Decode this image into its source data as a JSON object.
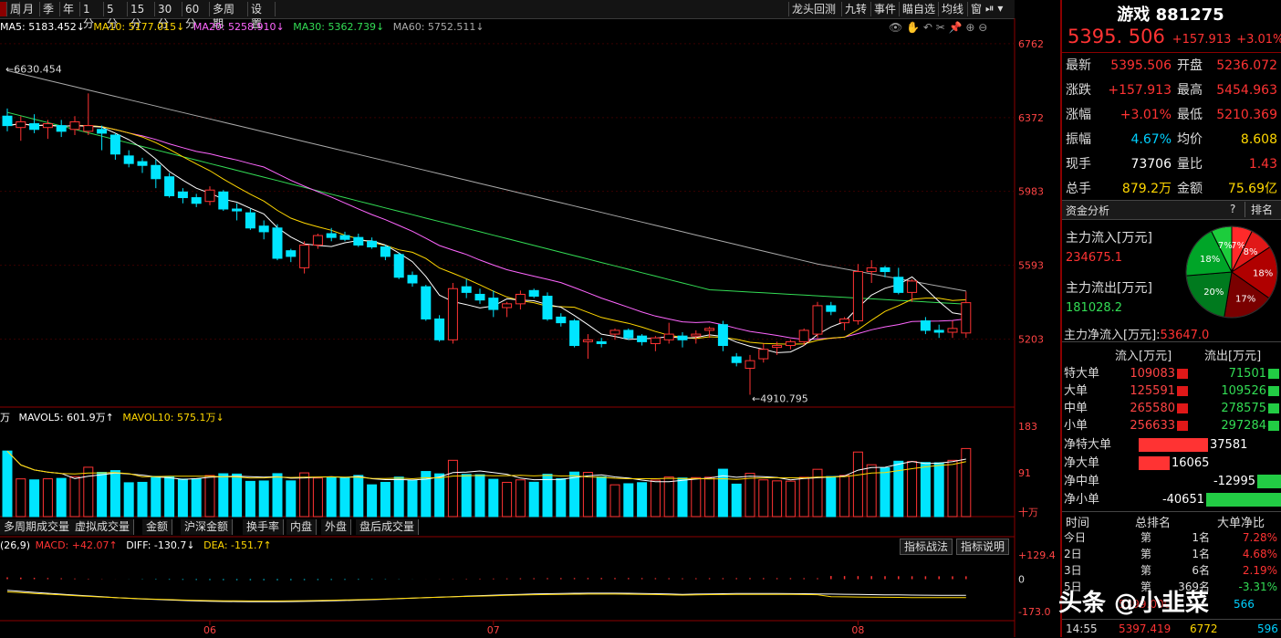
{
  "toolbar": {
    "periods": [
      "周",
      "月",
      "季",
      "年",
      "1分",
      "5分",
      "15分",
      "30分",
      "60分",
      "多周期",
      "设置"
    ],
    "active_period": "日",
    "right_tools": [
      "龙头回测",
      "九转",
      "事件",
      "瞄自选",
      "均线",
      "窗"
    ]
  },
  "ma_bar": {
    "ma5": "MA5: 5183.452↓",
    "ma10": "MA10: 5177.015↓",
    "ma20": "MA20: 5258.910↓",
    "ma30": "MA30: 5362.739↓",
    "ma60": "MA60: 5752.511↓"
  },
  "price_axis": [
    "6762",
    "6372",
    "5983",
    "5593",
    "5203"
  ],
  "price_annotations": {
    "high": "6630.454",
    "low": "4910.795"
  },
  "vol_bar": {
    "unit": "万",
    "mavol5": "MAVOL5: 601.9万↑",
    "mavol10": "MAVOL10: 575.1万↓"
  },
  "vol_axis": [
    "183",
    "91",
    "十万"
  ],
  "sub_tabs": [
    "多周期成交量",
    "虚拟成交量",
    "金额",
    "沪深金额",
    "换手率",
    "内盘",
    "外盘",
    "盘后成交量"
  ],
  "macd_bar": {
    "params": "(26,9)",
    "macd": "MACD: +42.07↑",
    "diff": "DIFF: -130.7↓",
    "dea": "DEA: -151.7↑"
  },
  "macd_axis": [
    "+129.4",
    "0",
    "-173.0"
  ],
  "macd_buttons": [
    "指标战法",
    "指标说明"
  ],
  "x_axis": [
    "06",
    "07",
    "08"
  ],
  "header": {
    "name": "游戏",
    "code": "881275",
    "price": "5395. 506",
    "change": "+157.913",
    "pct": "+3.01%"
  },
  "quote": [
    {
      "l1": "最新",
      "v1": "5395.506",
      "c1": "red",
      "l2": "开盘",
      "v2": "5236.072",
      "c2": "red"
    },
    {
      "l1": "涨跌",
      "v1": "+157.913",
      "c1": "red",
      "l2": "最高",
      "v2": "5454.963",
      "c2": "red"
    },
    {
      "l1": "涨幅",
      "v1": "+3.01%",
      "c1": "red",
      "l2": "最低",
      "v2": "5210.369",
      "c2": "red"
    },
    {
      "l1": "振幅",
      "v1": "4.67%",
      "c1": "cyan",
      "l2": "均价",
      "v2": "8.608",
      "c2": "yellow"
    },
    {
      "l1": "现手",
      "v1": "73706",
      "c1": "white",
      "l2": "量比",
      "v2": "1.43",
      "c2": "red"
    },
    {
      "l1": "总手",
      "v1": "879.2万",
      "c1": "yellow",
      "l2": "金额",
      "v2": "75.69亿",
      "c2": "yellow"
    }
  ],
  "fund": {
    "title": "资金分析",
    "help": "?",
    "rank_btn": "排名",
    "inflow_label": "主力流入[万元]",
    "inflow_value": "234675.1",
    "outflow_label": "主力流出[万元]",
    "outflow_value": "181028.2",
    "net_label": "主力净流入[万元]:",
    "net_value": "53647.0",
    "pie": [
      {
        "pct": 7,
        "label": "7%",
        "color": "#ff2a2a"
      },
      {
        "pct": 8,
        "label": "8%",
        "color": "#e01818"
      },
      {
        "pct": 18,
        "label": "18%",
        "color": "#b00000"
      },
      {
        "pct": 17,
        "label": "17%",
        "color": "#7a0000"
      },
      {
        "pct": 20,
        "label": "20%",
        "color": "#007a1e"
      },
      {
        "pct": 18,
        "label": "18%",
        "color": "#00a528"
      },
      {
        "pct": 7,
        "label": "7%",
        "color": "#1ccc3c"
      }
    ]
  },
  "flow_table": {
    "h_in": "流入[万元]",
    "h_out": "流出[万元]",
    "rows": [
      {
        "label": "特大单",
        "in": "109083",
        "out": "71501"
      },
      {
        "label": "大单",
        "in": "125591",
        "out": "109526"
      },
      {
        "label": "中单",
        "in": "265580",
        "out": "278575"
      },
      {
        "label": "小单",
        "in": "256633",
        "out": "297284"
      }
    ],
    "net": [
      {
        "label": "净特大单",
        "value": "37581",
        "color": "#ff3333",
        "w": 76
      },
      {
        "label": "净大单",
        "value": "16065",
        "color": "#ff3333",
        "w": 34
      },
      {
        "label": "净中单",
        "value": "-12995",
        "color": "#22cc44",
        "w": 26
      },
      {
        "label": "净小单",
        "value": "-40651",
        "color": "#22cc44",
        "w": 82
      }
    ]
  },
  "rank_table": {
    "h_time": "时间",
    "h_rank": "总排名",
    "h_ratio": "大单净比",
    "rows": [
      {
        "t": "今日",
        "p": "第",
        "r": "1名",
        "ratio": "7.28%"
      },
      {
        "t": "2日",
        "p": "第",
        "r": "1名",
        "ratio": "4.68%"
      },
      {
        "t": "3日",
        "p": "第",
        "r": "6名",
        "ratio": "2.19%"
      },
      {
        "t": "5日",
        "p": "第",
        "r": "369名",
        "ratio": "-3.31%"
      }
    ]
  },
  "tick": {
    "time": "14:55",
    "price": "5397.419",
    "vol": "6772",
    "extra": "596"
  },
  "tick_prev": {
    "extra": "566",
    "price": "5399.000"
  },
  "watermark": "头条 @小韭菜",
  "colors": {
    "up": "#ff3333",
    "down": "#00e5ff",
    "ma5": "#ffffff",
    "ma10": "#ffd700",
    "ma20": "#ff66ff",
    "ma30": "#33dd55",
    "ma60": "#aaaaaa"
  },
  "chart_data": {
    "type": "candlestick",
    "ylim": [
      4850,
      6800
    ],
    "candles": [
      [
        6380,
        6420,
        6300,
        6330
      ],
      [
        6320,
        6380,
        6250,
        6350
      ],
      [
        6340,
        6390,
        6290,
        6310
      ],
      [
        6320,
        6360,
        6260,
        6340
      ],
      [
        6330,
        6360,
        6270,
        6300
      ],
      [
        6310,
        6380,
        6280,
        6350
      ],
      [
        6300,
        6500,
        6280,
        6330
      ],
      [
        6310,
        6330,
        6200,
        6290
      ],
      [
        6280,
        6290,
        6150,
        6180
      ],
      [
        6170,
        6200,
        6110,
        6130
      ],
      [
        6140,
        6160,
        6080,
        6120
      ],
      [
        6120,
        6150,
        6000,
        6050
      ],
      [
        6060,
        6080,
        5950,
        5960
      ],
      [
        5980,
        6000,
        5920,
        5950
      ],
      [
        5950,
        5970,
        5900,
        5920
      ],
      [
        5930,
        6010,
        5910,
        5990
      ],
      [
        5980,
        5990,
        5880,
        5890
      ],
      [
        5890,
        5920,
        5830,
        5880
      ],
      [
        5870,
        5890,
        5780,
        5790
      ],
      [
        5800,
        5830,
        5730,
        5770
      ],
      [
        5790,
        5810,
        5620,
        5630
      ],
      [
        5670,
        5680,
        5610,
        5640
      ],
      [
        5580,
        5720,
        5550,
        5700
      ],
      [
        5700,
        5760,
        5680,
        5750
      ],
      [
        5760,
        5790,
        5720,
        5740
      ],
      [
        5750,
        5770,
        5720,
        5730
      ],
      [
        5740,
        5760,
        5690,
        5700
      ],
      [
        5720,
        5740,
        5680,
        5690
      ],
      [
        5690,
        5700,
        5620,
        5640
      ],
      [
        5650,
        5660,
        5520,
        5530
      ],
      [
        5540,
        5560,
        5480,
        5500
      ],
      [
        5480,
        5490,
        5300,
        5310
      ],
      [
        5310,
        5330,
        5190,
        5200
      ],
      [
        5200,
        5500,
        5180,
        5470
      ],
      [
        5480,
        5520,
        5420,
        5450
      ],
      [
        5440,
        5470,
        5390,
        5410
      ],
      [
        5420,
        5460,
        5320,
        5360
      ],
      [
        5370,
        5400,
        5320,
        5390
      ],
      [
        5390,
        5460,
        5360,
        5440
      ],
      [
        5460,
        5470,
        5420,
        5430
      ],
      [
        5430,
        5450,
        5300,
        5310
      ],
      [
        5320,
        5340,
        5270,
        5290
      ],
      [
        5300,
        5310,
        5160,
        5170
      ],
      [
        5190,
        5230,
        5100,
        5200
      ],
      [
        5190,
        5210,
        5160,
        5180
      ],
      [
        5230,
        5260,
        5200,
        5250
      ],
      [
        5250,
        5260,
        5200,
        5210
      ],
      [
        5220,
        5230,
        5170,
        5190
      ],
      [
        5180,
        5220,
        5140,
        5210
      ],
      [
        5200,
        5290,
        5180,
        5230
      ],
      [
        5220,
        5240,
        5160,
        5200
      ],
      [
        5220,
        5250,
        5180,
        5230
      ],
      [
        5250,
        5270,
        5210,
        5260
      ],
      [
        5280,
        5300,
        5140,
        5170
      ],
      [
        5110,
        5130,
        5060,
        5080
      ],
      [
        5050,
        5120,
        4910,
        5090
      ],
      [
        5100,
        5180,
        5080,
        5150
      ],
      [
        5160,
        5190,
        5120,
        5170
      ],
      [
        5170,
        5200,
        5150,
        5190
      ],
      [
        5190,
        5260,
        5170,
        5250
      ],
      [
        5230,
        5400,
        5210,
        5380
      ],
      [
        5380,
        5400,
        5330,
        5350
      ],
      [
        5290,
        5320,
        5250,
        5310
      ],
      [
        5300,
        5600,
        5280,
        5560
      ],
      [
        5560,
        5620,
        5500,
        5580
      ],
      [
        5580,
        5590,
        5530,
        5560
      ],
      [
        5530,
        5580,
        5440,
        5450
      ],
      [
        5450,
        5520,
        5400,
        5510
      ],
      [
        5300,
        5320,
        5230,
        5250
      ],
      [
        5250,
        5280,
        5210,
        5240
      ],
      [
        5240,
        5300,
        5210,
        5260
      ],
      [
        5236,
        5455,
        5210,
        5396
      ]
    ]
  }
}
